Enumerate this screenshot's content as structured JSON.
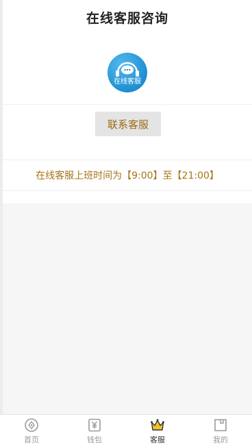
{
  "header": {
    "title": "在线客服咨询"
  },
  "logo": {
    "text": "在线客服"
  },
  "contact": {
    "button_label": "联系客服"
  },
  "hours": {
    "text": "在线客服上班时间为【9:00】至【21:00】"
  },
  "tabbar": {
    "items": [
      {
        "label": "首页",
        "icon": "home-compass-icon",
        "active": false
      },
      {
        "label": "钱包",
        "icon": "wallet-yen-icon",
        "active": false
      },
      {
        "label": "客服",
        "icon": "crown-icon",
        "active": true
      },
      {
        "label": "我的",
        "icon": "profile-card-icon",
        "active": false
      }
    ]
  },
  "colors": {
    "accent_text": "#a57518",
    "button_bg": "#e4e4e4",
    "logo_blue": "#1f8fd2",
    "crown_yellow": "#f2c230",
    "tab_inactive": "#999999"
  }
}
